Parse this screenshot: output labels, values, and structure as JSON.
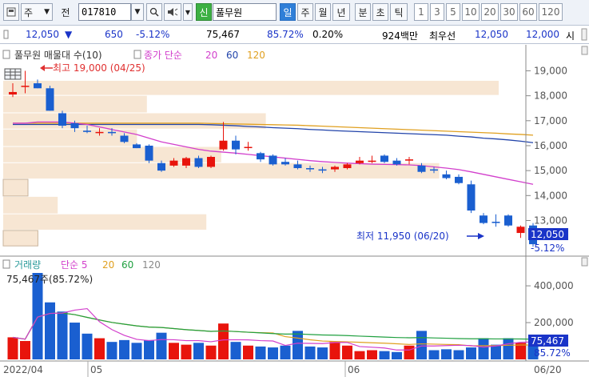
{
  "toolbar": {
    "type_label": "주",
    "prefix_label": "전",
    "code": "017810",
    "stock_name": "풀무원",
    "badge": "신",
    "periods": [
      "일",
      "주",
      "월",
      "년",
      "분",
      "초",
      "틱"
    ],
    "intervals": [
      "1",
      "3",
      "5",
      "10",
      "20",
      "30",
      "60",
      "120"
    ],
    "active_period": "일"
  },
  "quote": {
    "price": "12,050",
    "change": "650",
    "change_pct": "-5.12%",
    "volume": "75,467",
    "volume_ratio": "85.72%",
    "turnover": "0.20%",
    "amount": "924백만",
    "best_label": "최우선",
    "ask": "12,050",
    "bid": "12,000",
    "tail": "시"
  },
  "price_panel": {
    "legend_title": "풀무원 매물대 수(10)",
    "ma_label": "종가 단순",
    "ma_periods": [
      "20",
      "60",
      "120"
    ],
    "high_label": "최고 19,000 (04/25)",
    "low_label": "최저 11,950 (06/20)",
    "axis_ticks": [
      "19,000",
      "18,000",
      "17,000",
      "16,000",
      "15,000",
      "14,000",
      "13,000"
    ],
    "current_price": "12,050",
    "current_pct": "-5.12%"
  },
  "volume_panel": {
    "legend_title": "거래량",
    "ma_label": "단순 5",
    "ma_periods": [
      "20",
      "60",
      "120"
    ],
    "current_label": "75,467주(85.72%)",
    "axis_ticks": [
      "400,000",
      "200,000"
    ],
    "current_volume": "75,467",
    "current_pct": "85.72%"
  },
  "x_axis": {
    "labels": [
      "2022/04",
      "05",
      "06",
      "06/20"
    ]
  },
  "chart_data": {
    "type": "candlestick",
    "price_range": [
      11700,
      19400
    ],
    "volume_range": [
      0,
      470000
    ],
    "candles": [
      {
        "o": 18050,
        "h": 18500,
        "l": 17950,
        "c": 18150
      },
      {
        "o": 18400,
        "h": 19000,
        "l": 18100,
        "c": 18400
      },
      {
        "o": 18500,
        "h": 18650,
        "l": 18300,
        "c": 18300
      },
      {
        "o": 18300,
        "h": 18400,
        "l": 17400,
        "c": 17400
      },
      {
        "o": 17300,
        "h": 17400,
        "l": 16700,
        "c": 16800
      },
      {
        "o": 16900,
        "h": 17000,
        "l": 16550,
        "c": 16700
      },
      {
        "o": 16600,
        "h": 16800,
        "l": 16500,
        "c": 16550
      },
      {
        "o": 16550,
        "h": 16700,
        "l": 16400,
        "c": 16550
      },
      {
        "o": 16550,
        "h": 16700,
        "l": 16400,
        "c": 16500
      },
      {
        "o": 16400,
        "h": 16500,
        "l": 16100,
        "c": 16150
      },
      {
        "o": 16050,
        "h": 16100,
        "l": 15900,
        "c": 15900
      },
      {
        "o": 16000,
        "h": 16050,
        "l": 15300,
        "c": 15400
      },
      {
        "o": 15300,
        "h": 15400,
        "l": 14950,
        "c": 15000
      },
      {
        "o": 15200,
        "h": 15500,
        "l": 15150,
        "c": 15400
      },
      {
        "o": 15200,
        "h": 15550,
        "l": 15100,
        "c": 15500
      },
      {
        "o": 15500,
        "h": 15600,
        "l": 15100,
        "c": 15150
      },
      {
        "o": 15150,
        "h": 15600,
        "l": 15100,
        "c": 15550
      },
      {
        "o": 15850,
        "h": 16950,
        "l": 15800,
        "c": 16200
      },
      {
        "o": 16200,
        "h": 16400,
        "l": 15650,
        "c": 15850
      },
      {
        "o": 15950,
        "h": 16150,
        "l": 15800,
        "c": 15950
      },
      {
        "o": 15700,
        "h": 15750,
        "l": 15350,
        "c": 15450
      },
      {
        "o": 15600,
        "h": 15650,
        "l": 15200,
        "c": 15250
      },
      {
        "o": 15350,
        "h": 15500,
        "l": 15200,
        "c": 15250
      },
      {
        "o": 15250,
        "h": 15400,
        "l": 15050,
        "c": 15100
      },
      {
        "o": 15100,
        "h": 15200,
        "l": 14950,
        "c": 15050
      },
      {
        "o": 15050,
        "h": 15150,
        "l": 14900,
        "c": 15000
      },
      {
        "o": 15050,
        "h": 15200,
        "l": 14950,
        "c": 15150
      },
      {
        "o": 15100,
        "h": 15300,
        "l": 15050,
        "c": 15250
      },
      {
        "o": 15300,
        "h": 15550,
        "l": 15250,
        "c": 15400
      },
      {
        "o": 15350,
        "h": 15600,
        "l": 15300,
        "c": 15400
      },
      {
        "o": 15600,
        "h": 15650,
        "l": 15300,
        "c": 15350
      },
      {
        "o": 15400,
        "h": 15500,
        "l": 15200,
        "c": 15250
      },
      {
        "o": 15400,
        "h": 15550,
        "l": 15250,
        "c": 15450
      },
      {
        "o": 15200,
        "h": 15300,
        "l": 14900,
        "c": 14950
      },
      {
        "o": 15050,
        "h": 15150,
        "l": 14900,
        "c": 15000
      },
      {
        "o": 14850,
        "h": 15000,
        "l": 14650,
        "c": 14700
      },
      {
        "o": 14750,
        "h": 14850,
        "l": 14450,
        "c": 14500
      },
      {
        "o": 14450,
        "h": 14600,
        "l": 13300,
        "c": 13400
      },
      {
        "o": 13200,
        "h": 13300,
        "l": 12850,
        "c": 12900
      },
      {
        "o": 12950,
        "h": 13250,
        "l": 12750,
        "c": 12900
      },
      {
        "o": 13200,
        "h": 13250,
        "l": 12750,
        "c": 12800
      },
      {
        "o": 12500,
        "h": 12800,
        "l": 12300,
        "c": 12750
      },
      {
        "o": 12800,
        "h": 12900,
        "l": 11950,
        "c": 12050
      }
    ],
    "volumes": [
      120000,
      100000,
      470000,
      310000,
      260000,
      200000,
      140000,
      115000,
      95000,
      105000,
      90000,
      105000,
      145000,
      90000,
      80000,
      90000,
      75000,
      195000,
      95000,
      75000,
      70000,
      65000,
      75000,
      155000,
      70000,
      65000,
      95000,
      75000,
      45000,
      50000,
      45000,
      40000,
      75000,
      155000,
      50000,
      55000,
      50000,
      65000,
      115000,
      80000,
      115000,
      90000,
      75000
    ],
    "ma20": [
      16900,
      16900,
      16950,
      16950,
      16950,
      16900,
      16850,
      16750,
      16650,
      16550,
      16450,
      16300,
      16150,
      16050,
      15950,
      15850,
      15780,
      15740,
      15700,
      15650,
      15600,
      15550,
      15500,
      15450,
      15400,
      15360,
      15330,
      15300,
      15280,
      15260,
      15250,
      15240,
      15230,
      15200,
      15150,
      15100,
      15040,
      14950,
      14850,
      14750,
      14650,
      14550,
      14450
    ],
    "ma60": [
      16850,
      16850,
      16850,
      16850,
      16850,
      16850,
      16850,
      16850,
      16850,
      16850,
      16850,
      16850,
      16850,
      16850,
      16850,
      16850,
      16840,
      16820,
      16800,
      16770,
      16750,
      16720,
      16700,
      16680,
      16650,
      16630,
      16600,
      16580,
      16560,
      16540,
      16520,
      16500,
      16480,
      16460,
      16440,
      16420,
      16380,
      16350,
      16300,
      16270,
      16230,
      16180,
      16120
    ],
    "ma120": [
      16900,
      16900,
      16900,
      16900,
      16900,
      16900,
      16900,
      16900,
      16900,
      16900,
      16900,
      16900,
      16900,
      16900,
      16900,
      16900,
      16890,
      16880,
      16870,
      16860,
      16850,
      16840,
      16830,
      16820,
      16800,
      16780,
      16760,
      16740,
      16720,
      16700,
      16680,
      16660,
      16640,
      16620,
      16600,
      16580,
      16560,
      16540,
      16520,
      16500,
      16470,
      16450,
      16420
    ],
    "volume_profile": [
      {
        "from": 18000,
        "to": 18600,
        "strength": 1.0
      },
      {
        "from": 17300,
        "to": 18000,
        "strength": 0.29
      },
      {
        "from": 16650,
        "to": 17300,
        "strength": 0.53
      },
      {
        "from": 15950,
        "to": 16650,
        "strength": 0.27
      },
      {
        "from": 15300,
        "to": 15950,
        "strength": 0.44
      },
      {
        "from": 14650,
        "to": 15300,
        "strength": 0.88
      },
      {
        "from": 13950,
        "to": 14650,
        "strength": 0.05
      },
      {
        "from": 13250,
        "to": 13950,
        "strength": 0.11
      },
      {
        "from": 12600,
        "to": 13250,
        "strength": 0.41
      },
      {
        "from": 11950,
        "to": 12600,
        "strength": 0.07
      }
    ]
  }
}
